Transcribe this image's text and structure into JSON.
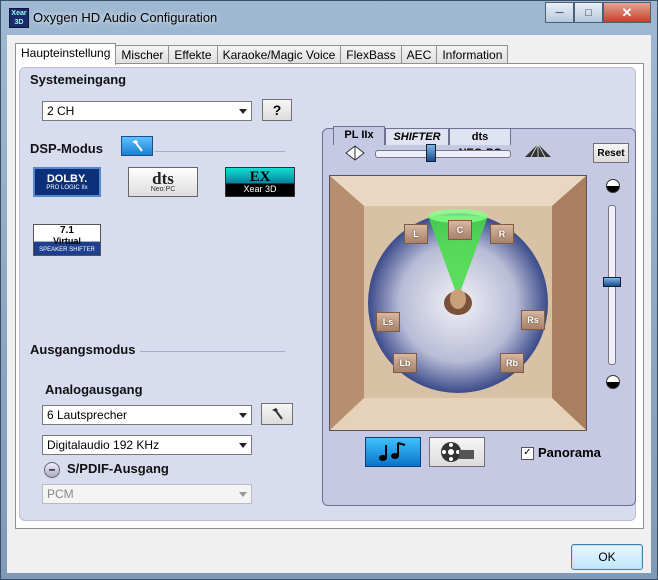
{
  "window": {
    "title": "Oxygen HD Audio Configuration",
    "app_icon_text": "Xear 3D"
  },
  "tabs": [
    {
      "label": "Haupteinstellung"
    },
    {
      "label": "Mischer"
    },
    {
      "label": "Effekte"
    },
    {
      "label": "Karaoke/Magic Voice"
    },
    {
      "label": "FlexBass"
    },
    {
      "label": "AEC"
    },
    {
      "label": "Information"
    }
  ],
  "systemeingang": {
    "title": "Systemeingang",
    "value": "2 CH",
    "help_label": "?"
  },
  "dsp": {
    "title": "DSP-Modus",
    "logos": {
      "dolby_main": "DOLBY.",
      "dolby_sub": "PRO LOGIC IIx",
      "dts_main": "dts",
      "dts_sub": "Neo:PC",
      "ex_main": "EX",
      "ex_sub": "Xear 3D",
      "virtual_top": "7.1",
      "virtual_mid": "Virtual",
      "virtual_sub": "SPEAKER SHIFTER"
    }
  },
  "ausgang": {
    "title": "Ausgangsmodus",
    "analog_title": "Analogausgang",
    "analog_value": "6 Lautsprecher",
    "digital_value": "Digitalaudio  192 KHz",
    "spdif_title": "S/PDIF-Ausgang",
    "spdif_value": "PCM"
  },
  "surround": {
    "subtabs": [
      {
        "label": "PL IIx"
      },
      {
        "label": "SHIFTER"
      },
      {
        "label": "dts NEO:PC"
      }
    ],
    "reset_label": "Reset",
    "speakers": {
      "c": "C",
      "l": "L",
      "r": "R",
      "ls": "Ls",
      "rs": "Rs",
      "lb": "Lb",
      "rb": "Rb"
    },
    "horizontal_slider_level": 0.4,
    "vertical_slider_level": 0.48,
    "panorama_label": "Panorama",
    "panorama_checked": true
  },
  "footer": {
    "ok_label": "OK"
  },
  "colors": {
    "accent_blue": "#1a8ad8",
    "cone_green": "#44dd44"
  }
}
